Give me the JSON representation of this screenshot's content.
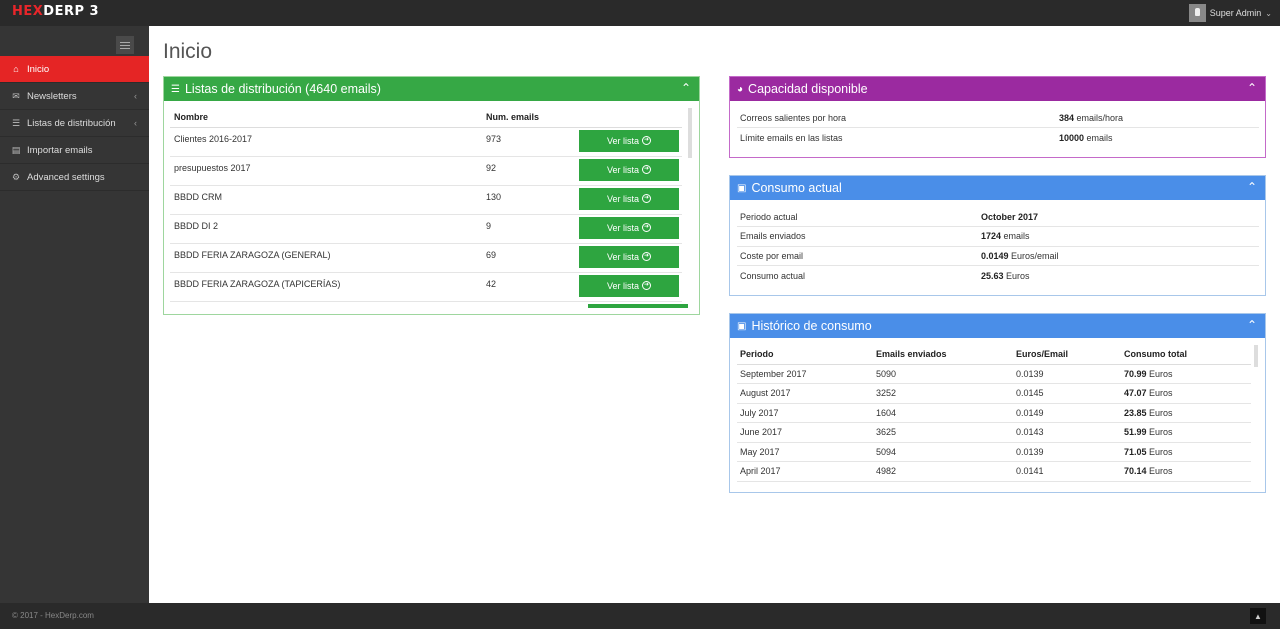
{
  "app": {
    "logo_prefix": "HEX",
    "logo_suffix": "DERP 3"
  },
  "user": {
    "name": "Super Admin"
  },
  "sidebar": {
    "items": [
      {
        "label": "Inicio",
        "icon": "home-icon",
        "active": true
      },
      {
        "label": "Newsletters",
        "icon": "envelope-icon",
        "has_submenu": true
      },
      {
        "label": "Listas de distribución",
        "icon": "list-icon",
        "has_submenu": true
      },
      {
        "label": "Importar emails",
        "icon": "inbox-icon"
      },
      {
        "label": "Advanced settings",
        "icon": "gears-icon"
      }
    ]
  },
  "page": {
    "title": "Inicio"
  },
  "listas": {
    "title": "Listas de distribución (4640 emails)",
    "columns": [
      "Nombre",
      "Num. emails"
    ],
    "button_label": "Ver lista",
    "rows": [
      {
        "name": "Clientes 2016-2017",
        "count": "973"
      },
      {
        "name": "presupuestos 2017",
        "count": "92"
      },
      {
        "name": "BBDD CRM",
        "count": "130"
      },
      {
        "name": "BBDD DI 2",
        "count": "9"
      },
      {
        "name": "BBDD FERIA ZARAGOZA (GENERAL)",
        "count": "69"
      },
      {
        "name": "BBDD FERIA ZARAGOZA (TAPICERÍAS)",
        "count": "42"
      }
    ]
  },
  "capacidad": {
    "title": "Capacidad disponible",
    "rows": [
      {
        "label": "Correos salientes por hora",
        "value": "384",
        "unit": " emails/hora"
      },
      {
        "label": "Límite emails en las listas",
        "value": "10000",
        "unit": " emails"
      }
    ]
  },
  "consumo": {
    "title": "Consumo actual",
    "rows": [
      {
        "label": "Periodo actual",
        "value": "October 2017",
        "unit": ""
      },
      {
        "label": "Emails enviados",
        "value": "1724",
        "unit": " emails"
      },
      {
        "label": "Coste por email",
        "value": "0.0149",
        "unit": " Euros/email"
      },
      {
        "label": "Consumo actual",
        "value": "25.63",
        "unit": " Euros"
      }
    ]
  },
  "historico": {
    "title": "Histórico de consumo",
    "columns": [
      "Periodo",
      "Emails enviados",
      "Euros/Email",
      "Consumo total"
    ],
    "unit": " Euros",
    "rows": [
      {
        "period": "September 2017",
        "sent": "5090",
        "rate": "0.0139",
        "total": "70.99"
      },
      {
        "period": "August 2017",
        "sent": "3252",
        "rate": "0.0145",
        "total": "47.07"
      },
      {
        "period": "July 2017",
        "sent": "1604",
        "rate": "0.0149",
        "total": "23.85"
      },
      {
        "period": "June 2017",
        "sent": "3625",
        "rate": "0.0143",
        "total": "51.99"
      },
      {
        "period": "May 2017",
        "sent": "5094",
        "rate": "0.0139",
        "total": "71.05"
      },
      {
        "period": "April 2017",
        "sent": "4982",
        "rate": "0.0141",
        "total": "70.14"
      }
    ]
  },
  "footer": {
    "text": "© 2017 - HexDerp.com"
  },
  "colors": {
    "accent_red": "#e52525",
    "green": "#36a845",
    "purple": "#9b2aa0",
    "blue": "#4a8ee8"
  }
}
